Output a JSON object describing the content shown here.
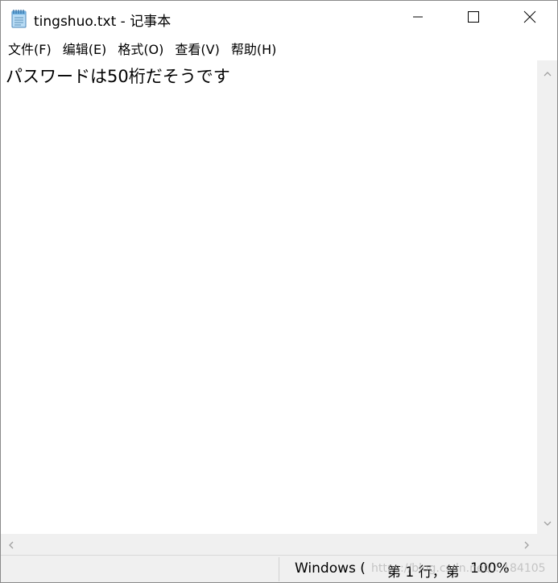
{
  "window": {
    "title": "tingshuo.txt - 记事本"
  },
  "menu": [
    {
      "label": "文件(F)"
    },
    {
      "label": "编辑(E)"
    },
    {
      "label": "格式(O)"
    },
    {
      "label": "查看(V)"
    },
    {
      "label": "帮助(H)"
    }
  ],
  "editor": {
    "content": "パスワードは50桁だそうです"
  },
  "statusbar": {
    "line_ending": "Windows (",
    "position": "第 1 行，第",
    "zoom": "100%",
    "watermark": "https://blog.csdn.net/...184105"
  },
  "icons": {
    "app": "notepad-icon",
    "minimize": "minimize-icon",
    "maximize": "maximize-icon",
    "close": "close-icon"
  }
}
